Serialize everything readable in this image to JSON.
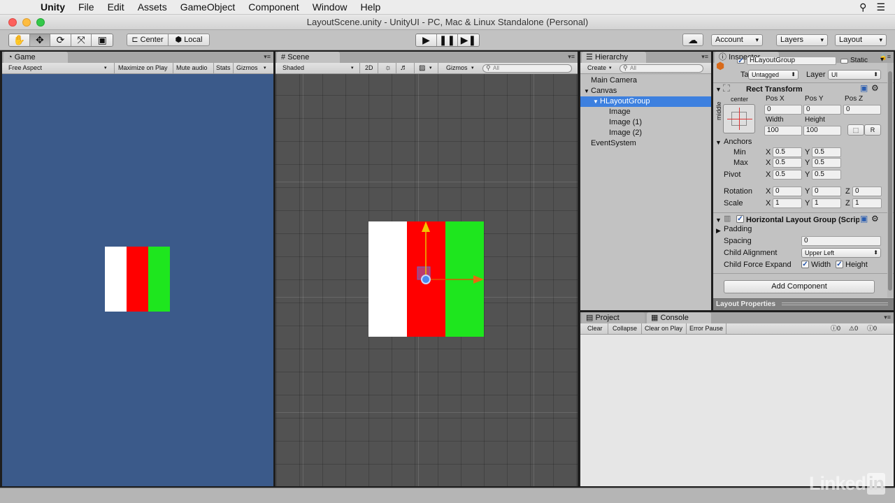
{
  "menubar": {
    "app": "Unity",
    "items": [
      "File",
      "Edit",
      "Assets",
      "GameObject",
      "Component",
      "Window",
      "Help"
    ]
  },
  "window": {
    "title": "LayoutScene.unity - UnityUI - PC, Mac & Linux Standalone (Personal)"
  },
  "toolbar": {
    "pivot_mode": "Center",
    "pivot_space": "Local",
    "account": "Account",
    "layers": "Layers",
    "layout": "Layout"
  },
  "game": {
    "tab": "Game",
    "aspect": "Free Aspect",
    "maximize": "Maximize on Play",
    "mute": "Mute audio",
    "stats": "Stats",
    "gizmos": "Gizmos",
    "background": "#3b5a8a"
  },
  "scene": {
    "tab": "Scene",
    "shading": "Shaded",
    "mode_2d": "2D",
    "gizmos": "Gizmos",
    "search_placeholder": "All",
    "background": "#525252"
  },
  "images": {
    "colors": [
      "#ffffff",
      "#ff0000",
      "#1ee61e"
    ]
  },
  "hierarchy": {
    "tab": "Hierarchy",
    "create": "Create",
    "search_placeholder": "All",
    "items": [
      {
        "label": "Main Camera",
        "level": 0
      },
      {
        "label": "Canvas",
        "level": 0,
        "expanded": true
      },
      {
        "label": "HLayoutGroup",
        "level": 1,
        "expanded": true,
        "selected": true
      },
      {
        "label": "Image",
        "level": 2
      },
      {
        "label": "Image (1)",
        "level": 2
      },
      {
        "label": "Image (2)",
        "level": 2
      },
      {
        "label": "EventSystem",
        "level": 0
      }
    ]
  },
  "inspector": {
    "tab": "Inspector",
    "object_name": "HLayoutGroup",
    "static_label": "Static",
    "tag_label": "Tag",
    "tag_value": "Untagged",
    "layer_label": "Layer",
    "layer_value": "UI",
    "rect": {
      "title": "Rect Transform",
      "anchor_h": "center",
      "anchor_v": "middle",
      "pos_x_label": "Pos X",
      "pos_y_label": "Pos Y",
      "pos_z_label": "Pos Z",
      "pos_x": "0",
      "pos_y": "0",
      "pos_z": "0",
      "width_label": "Width",
      "height_label": "Height",
      "width": "100",
      "height": "100",
      "r_button": "R",
      "anchors_label": "Anchors",
      "min_label": "Min",
      "max_label": "Max",
      "min_x": "0.5",
      "min_y": "0.5",
      "max_x": "0.5",
      "max_y": "0.5",
      "pivot_label": "Pivot",
      "pivot_x": "0.5",
      "pivot_y": "0.5",
      "rotation_label": "Rotation",
      "rot_x": "0",
      "rot_y": "0",
      "rot_z": "0",
      "scale_label": "Scale",
      "scale_x": "1",
      "scale_y": "1",
      "scale_z": "1",
      "x": "X",
      "y": "Y",
      "z": "Z"
    },
    "hlg": {
      "title": "Horizontal Layout Group (Script)",
      "padding_label": "Padding",
      "spacing_label": "Spacing",
      "spacing": "0",
      "alignment_label": "Child Alignment",
      "alignment": "Upper Left",
      "force_label": "Child Force Expand",
      "force_width": "Width",
      "force_height": "Height"
    },
    "add_component": "Add Component",
    "layout_properties": "Layout Properties"
  },
  "project": {
    "tab": "Project"
  },
  "console": {
    "tab": "Console",
    "buttons": [
      "Clear",
      "Collapse",
      "Clear on Play",
      "Error Pause"
    ],
    "counts": [
      "0",
      "0",
      "0"
    ]
  },
  "watermark": {
    "brand": "Linked",
    "in": "in"
  }
}
